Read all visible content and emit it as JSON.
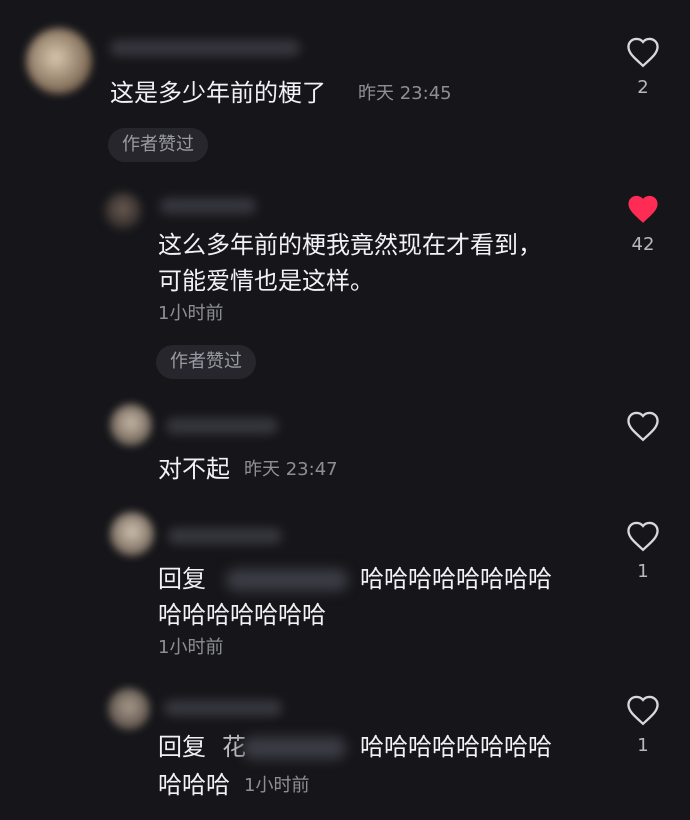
{
  "comments": [
    {
      "text": "这是多少年前的梗了",
      "time": "昨天 23:45",
      "likes": "2",
      "liked": false,
      "author_liked_label": "作者赞过"
    },
    {
      "line1": "这么多年前的梗我竟然现在才看到，",
      "line2": "可能爱情也是这样。",
      "time": "1小时前",
      "likes": "42",
      "liked": true,
      "author_liked_label": "作者赞过"
    },
    {
      "text": "对不起",
      "time": "昨天 23:47",
      "liked": false
    },
    {
      "reply_prefix": "回复",
      "line1_tail": "哈哈哈哈哈哈哈哈",
      "line2": "哈哈哈哈哈哈哈",
      "time": "1小时前",
      "likes": "1",
      "liked": false
    },
    {
      "reply_prefix": "回复",
      "reply_name_glyph": "花",
      "line1_tail": "哈哈哈哈哈哈哈哈",
      "line2": "哈哈哈",
      "time": "1小时前",
      "likes": "1",
      "liked": false
    }
  ],
  "colors": {
    "background": "#16161a",
    "liked_heart": "#fe2c55",
    "secondary_text": "#8e8e96"
  },
  "icons": {
    "like": "heart-outline-icon",
    "liked": "heart-filled-icon"
  }
}
